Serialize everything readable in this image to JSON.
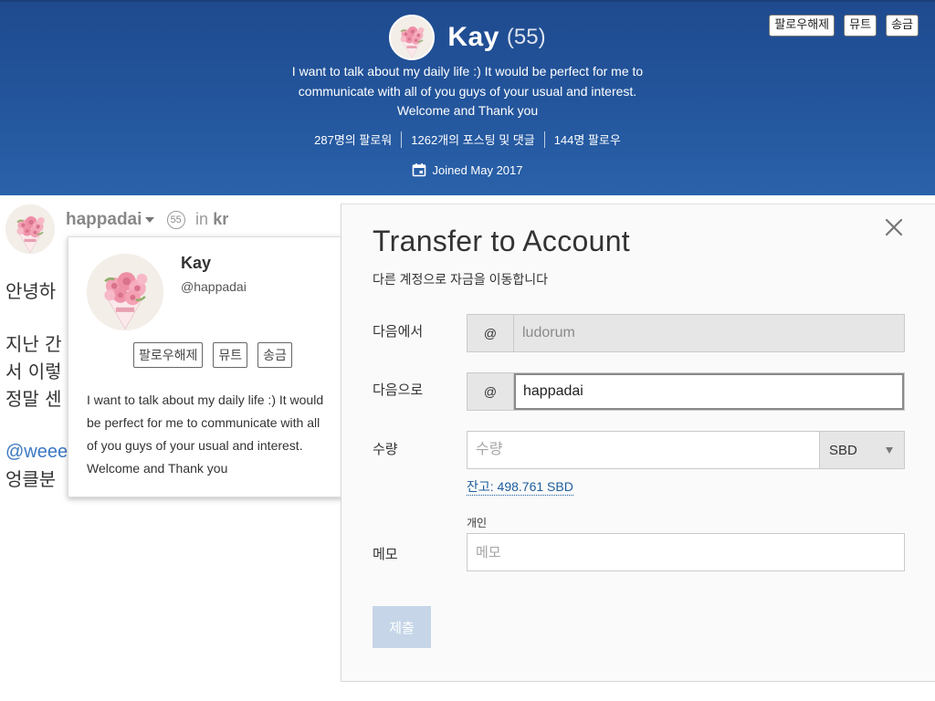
{
  "header": {
    "name": "Kay",
    "reputation": "(55)",
    "about_lines": [
      "I want to talk about my daily life :) It would be perfect for me to",
      "communicate with all of you guys of your usual and interest.",
      "Welcome and Thank you"
    ],
    "stats": {
      "followers": "287명의 팔로워",
      "posts": "1262개의 포스팅 및 댓글",
      "following": "144명 팔로우"
    },
    "joined": "Joined May 2017",
    "actions": {
      "unfollow": "팔로우해제",
      "mute": "뮤트",
      "transfer": "송금"
    },
    "colors": {
      "background": "#24579e",
      "text": "#ffffff"
    }
  },
  "post": {
    "author": "happadai",
    "reputation": "55",
    "in_label": "in",
    "category": "kr",
    "body_lines": [
      "안녕하",
      "지난 간",
      "서 이렇",
      "정말 센",
      "@weee",
      "엉클분"
    ]
  },
  "popover": {
    "name": "Kay",
    "handle": "@happadai",
    "actions": {
      "unfollow": "팔로우해제",
      "mute": "뮤트",
      "transfer": "송금"
    },
    "about_lines": [
      "I want to talk about my daily life :) It would",
      "be perfect for me to communicate with all",
      "of you guys of your usual and interest.",
      "Welcome and Thank you"
    ]
  },
  "transfer": {
    "title": "Transfer to Account",
    "subtitle": "다른 계정으로 자금을 이동합니다",
    "from": {
      "label": "다음에서",
      "prefix": "@",
      "value": "ludorum"
    },
    "to": {
      "label": "다음으로",
      "prefix": "@",
      "value": "happadai"
    },
    "amount": {
      "label": "수량",
      "placeholder": "수량",
      "currency": "SBD"
    },
    "balance": "잔고: 498.761 SBD",
    "memo": {
      "hint": "개인",
      "label": "메모",
      "placeholder": "메모"
    },
    "submit_label": "제출",
    "colors": {
      "link": "#1c5d9c",
      "submit_disabled": "#c6d6e8"
    }
  },
  "icons": {
    "close": "close-icon",
    "calendar": "calendar-icon",
    "caret": "caret-down-icon",
    "dropdown": "triangle-down-icon",
    "avatar": "rose-bouquet-avatar"
  }
}
